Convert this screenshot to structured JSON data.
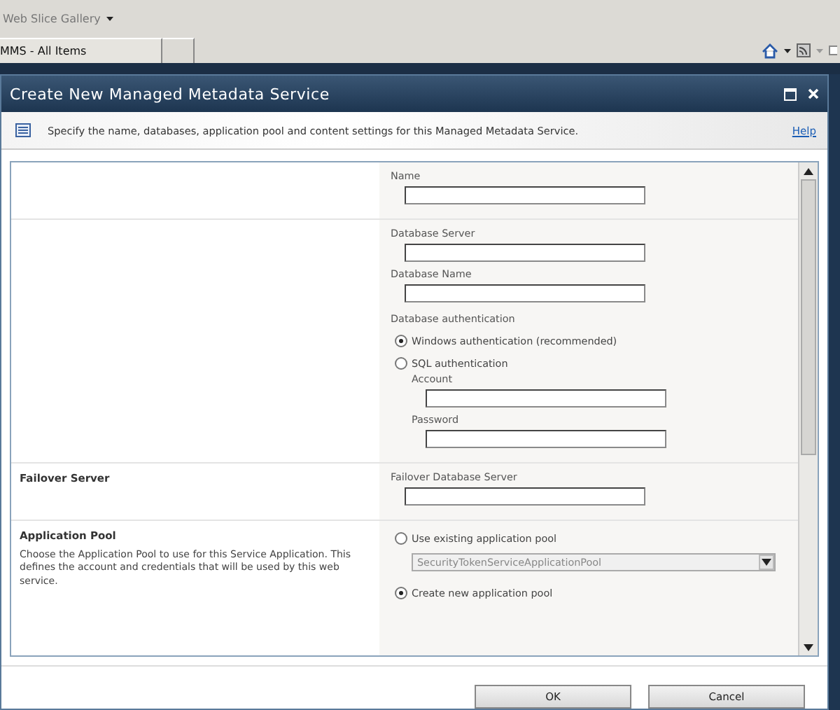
{
  "browser": {
    "menu_item": "Web Slice Gallery",
    "tabs": [
      {
        "label": "MMS - All Items",
        "selected": true
      }
    ]
  },
  "dialog": {
    "title": "Create New Managed Metadata Service",
    "description": "Specify the name, databases, application pool and content settings for this Managed Metadata Service.",
    "help_link": "Help",
    "sections": [
      {
        "fields": [
          {
            "kind": "text",
            "label": "Name"
          }
        ]
      },
      {
        "fields": [
          {
            "kind": "text",
            "label": "Database Server"
          },
          {
            "kind": "text",
            "label": "Database Name"
          },
          {
            "kind": "label",
            "label": "Database authentication"
          },
          {
            "kind": "radio",
            "label": "Windows authentication (recommended)",
            "selected": true
          },
          {
            "kind": "radio",
            "label": "SQL authentication",
            "selected": false,
            "children": [
              {
                "kind": "text",
                "label": "Account"
              },
              {
                "kind": "text",
                "label": "Password"
              }
            ]
          }
        ]
      },
      {
        "heading": "Failover Server",
        "fields": [
          {
            "kind": "text",
            "label": "Failover Database Server"
          }
        ]
      },
      {
        "heading": "Application Pool",
        "description": "Choose the Application Pool to use for this Service Application.  This defines the account and credentials that will be used by this web service.",
        "fields": [
          {
            "kind": "radio",
            "label": "Use existing application pool",
            "selected": false,
            "children": [
              {
                "kind": "select",
                "value": "SecurityTokenServiceApplicationPool",
                "disabled": true
              }
            ]
          },
          {
            "kind": "radio",
            "label": "Create new application pool",
            "selected": true
          }
        ]
      }
    ],
    "buttons": [
      "OK",
      "Cancel"
    ]
  }
}
